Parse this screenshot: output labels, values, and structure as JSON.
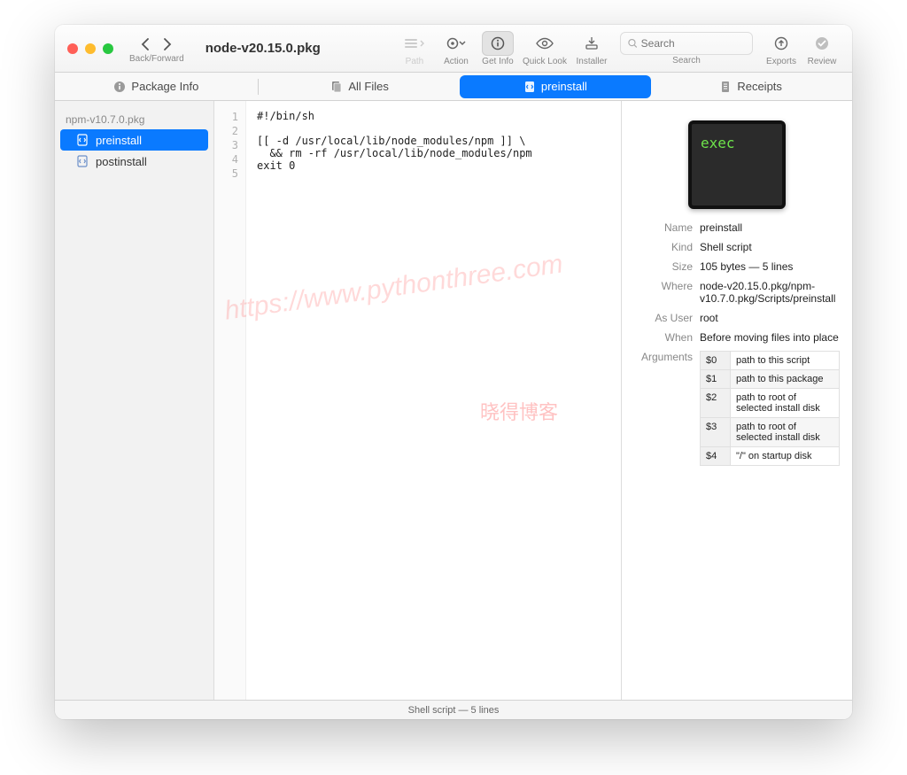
{
  "window": {
    "title": "node-v20.15.0.pkg"
  },
  "toolbar": {
    "back_forward_label": "Back/Forward",
    "path_label": "Path",
    "action_label": "Action",
    "getinfo_label": "Get Info",
    "quicklook_label": "Quick Look",
    "installer_label": "Installer",
    "search_placeholder": "Search",
    "search_label": "Search",
    "exports_label": "Exports",
    "review_label": "Review"
  },
  "tabs": {
    "package_info": "Package Info",
    "all_files": "All Files",
    "preinstall": "preinstall",
    "receipts": "Receipts"
  },
  "sidebar": {
    "pkg_header": "npm-v10.7.0.pkg",
    "items": [
      {
        "label": "preinstall",
        "selected": true
      },
      {
        "label": "postinstall",
        "selected": false
      }
    ]
  },
  "code": {
    "lines": [
      "#!/bin/sh",
      "",
      "[[ -d /usr/local/lib/node_modules/npm ]] \\",
      "  && rm -rf /usr/local/lib/node_modules/npm",
      "exit 0"
    ]
  },
  "info": {
    "exec_badge": "exec",
    "name_key": "Name",
    "name_val": "preinstall",
    "kind_key": "Kind",
    "kind_val": "Shell script",
    "size_key": "Size",
    "size_val": "105 bytes — 5 lines",
    "where_key": "Where",
    "where_val": "node-v20.15.0.pkg/npm-v10.7.0.pkg/Scripts/preinstall",
    "asuser_key": "As User",
    "asuser_val": "root",
    "when_key": "When",
    "when_val": "Before moving files into place",
    "args_key": "Arguments",
    "args": [
      {
        "k": "$0",
        "v": "path to this script"
      },
      {
        "k": "$1",
        "v": "path to this package"
      },
      {
        "k": "$2",
        "v": "path to root of selected install disk"
      },
      {
        "k": "$3",
        "v": "path to root of selected install disk"
      },
      {
        "k": "$4",
        "v": "\"/\" on startup disk"
      }
    ]
  },
  "statusbar": "Shell script — 5 lines",
  "watermark_url": "https://www.pythonthree.com",
  "watermark_cn": "晓得博客"
}
